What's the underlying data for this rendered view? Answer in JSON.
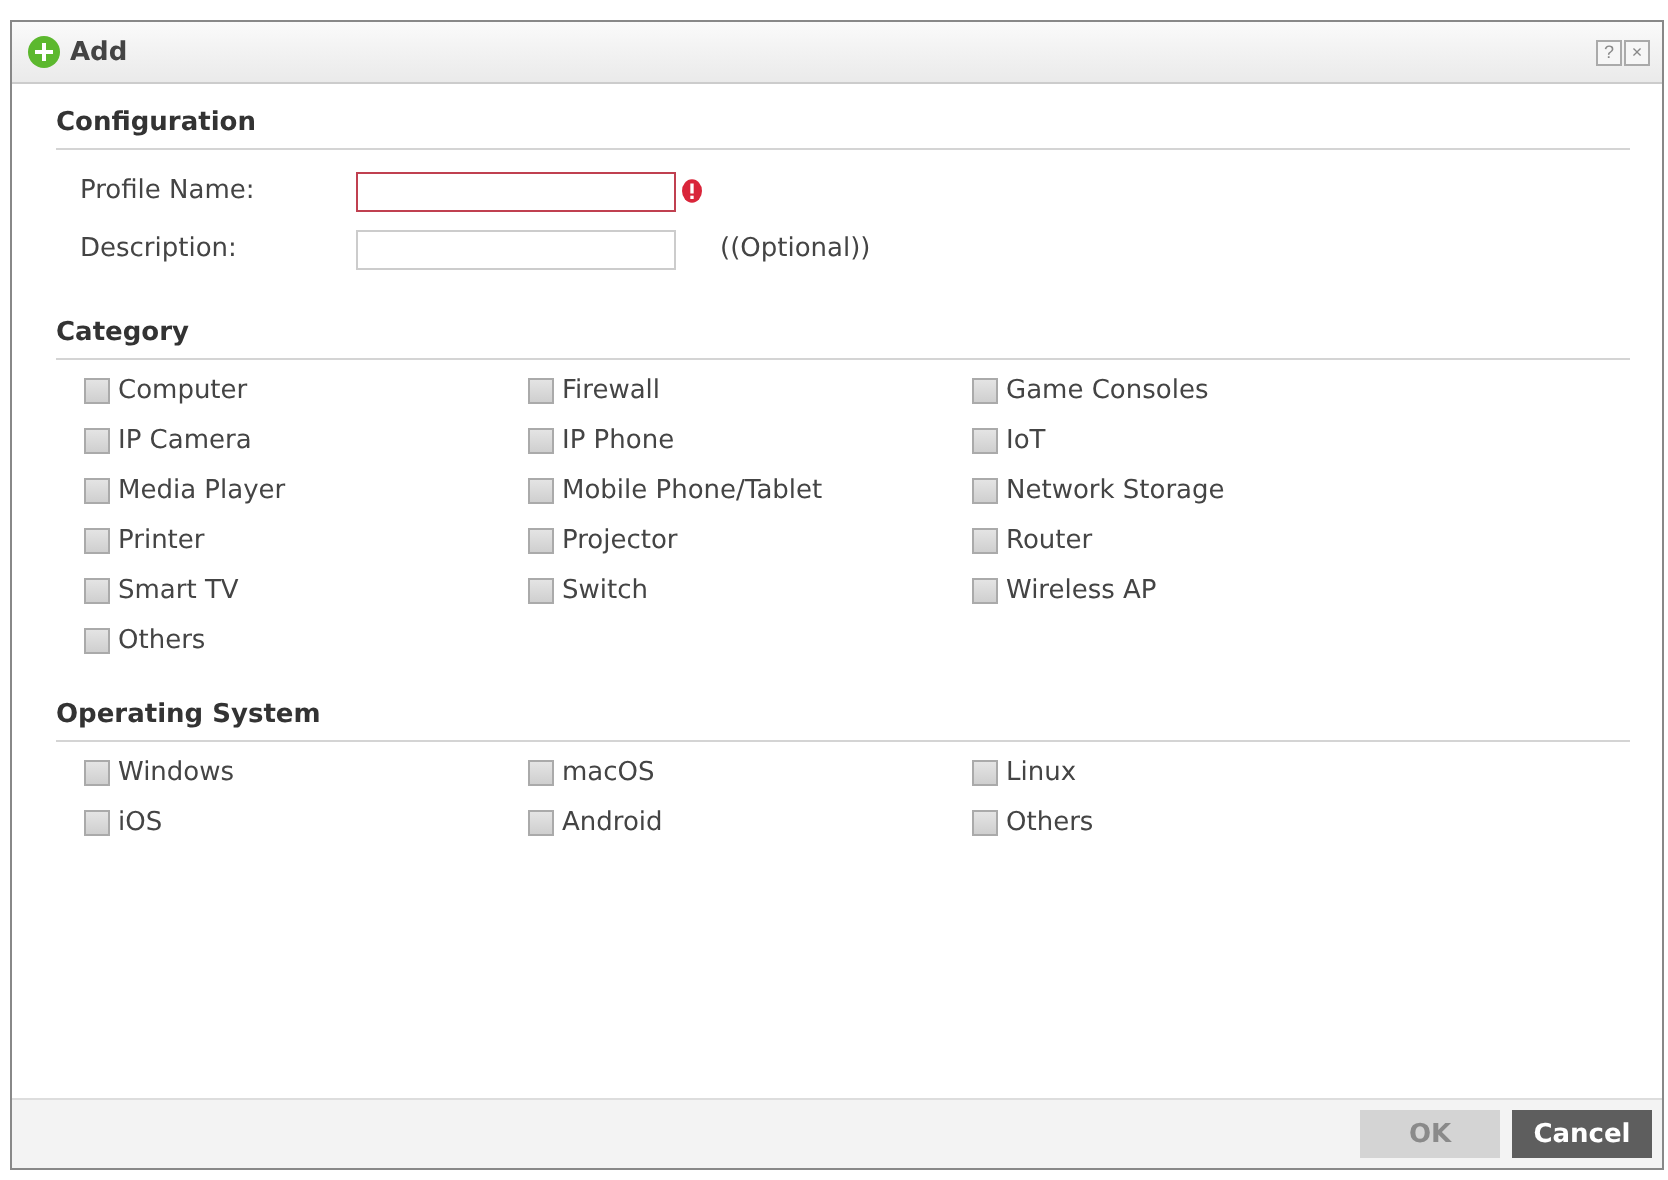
{
  "window": {
    "title": "Add"
  },
  "title_buttons": [
    "?",
    "×"
  ],
  "configuration": {
    "heading": "Configuration",
    "fields": [
      {
        "label": "Profile Name:",
        "required": true
      },
      {
        "label": "Description:",
        "required": false,
        "note": "((Optional))"
      }
    ]
  },
  "category": {
    "heading": "Category",
    "items": [
      {
        "label": "Computer",
        "checked": false
      },
      {
        "label": "Firewall",
        "checked": false
      },
      {
        "label": "Game Consoles",
        "checked": false
      },
      {
        "label": "IP Camera",
        "checked": false
      },
      {
        "label": "IP Phone",
        "checked": false
      },
      {
        "label": "IoT",
        "checked": false
      },
      {
        "label": "Media Player",
        "checked": false
      },
      {
        "label": "Mobile Phone/Tablet",
        "checked": false
      },
      {
        "label": "Network Storage",
        "checked": false
      },
      {
        "label": "Printer",
        "checked": false
      },
      {
        "label": "Projector",
        "checked": false
      },
      {
        "label": "Router",
        "checked": false
      },
      {
        "label": "Smart TV",
        "checked": false
      },
      {
        "label": "Switch",
        "checked": false
      },
      {
        "label": "Wireless AP",
        "checked": false
      },
      {
        "label": "Others",
        "checked": false
      }
    ]
  },
  "operating_system": {
    "heading": "Operating System",
    "items": [
      {
        "label": "Windows",
        "checked": false
      },
      {
        "label": "macOS",
        "checked": false
      },
      {
        "label": "Linux",
        "checked": false
      },
      {
        "label": "iOS",
        "checked": false
      },
      {
        "label": "Android",
        "checked": false
      },
      {
        "label": "Others",
        "checked": false
      }
    ]
  },
  "buttons": [
    {
      "label": "OK",
      "disabled": true
    },
    {
      "label": "Cancel",
      "disabled": false
    }
  ]
}
